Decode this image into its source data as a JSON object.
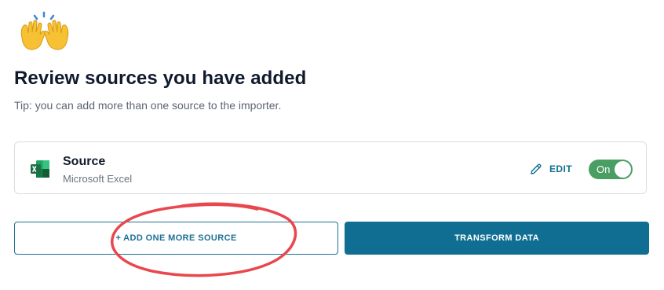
{
  "header": {
    "title": "Review sources you have added",
    "tip": "Tip: you can add more than one source to the importer."
  },
  "source": {
    "name": "Source",
    "type": "Microsoft Excel",
    "edit_label": "EDIT",
    "toggle_label": "On",
    "toggle_on": true
  },
  "actions": {
    "add_label": "+ ADD ONE MORE SOURCE",
    "transform_label": "TRANSFORM DATA"
  },
  "icons": {
    "header": "raising-hands-emoji",
    "source": "excel-icon",
    "edit": "pencil-icon"
  },
  "colors": {
    "accent": "#0f6e91",
    "toggle_on": "#4a9e64",
    "annotation": "#e8474e",
    "excel_green": "#1d6f42"
  }
}
